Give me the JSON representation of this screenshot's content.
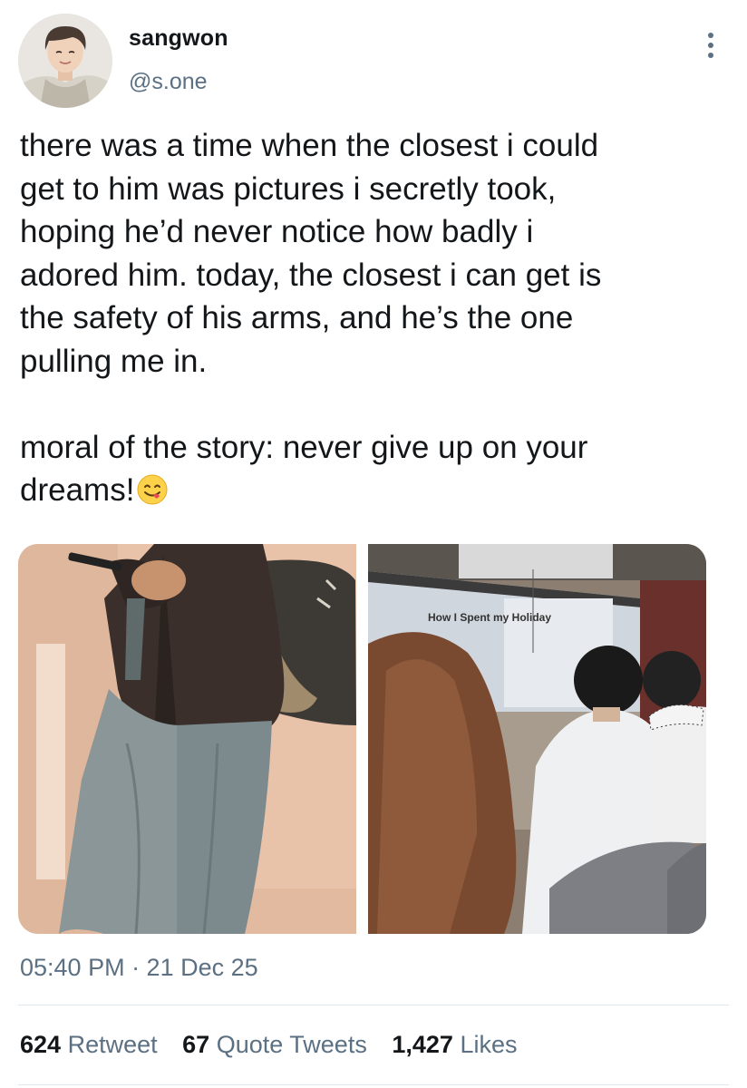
{
  "user": {
    "display_name": "sangwon",
    "handle": "@s.one"
  },
  "tweet": {
    "text": "there was a time when the closest i could\nget to him was pictures i secretly took,\nhoping he’d never notice how badly i\nadored him. today, the closest i can get is\nthe safety of his arms, and he’s the one\npulling me in.\n\nmoral of the story: never give up on your\ndreams!",
    "emoji": "😋",
    "timestamp": "05:40 PM · 21 Dec 25"
  },
  "media": {
    "right_photo_screen_text": "How I Spent my Holiday"
  },
  "stats": {
    "retweets": "624",
    "retweets_label": "Retweet",
    "quotes": "67",
    "quotes_label": "Quote Tweets",
    "likes": "1,427",
    "likes_label": "Likes"
  },
  "icons": {
    "more": "more-vertical-icon",
    "emoji": "face-savoring-food-emoji"
  },
  "colors": {
    "text": "#14171a",
    "secondary": "#5b7083",
    "divider": "#e1e8ed"
  }
}
